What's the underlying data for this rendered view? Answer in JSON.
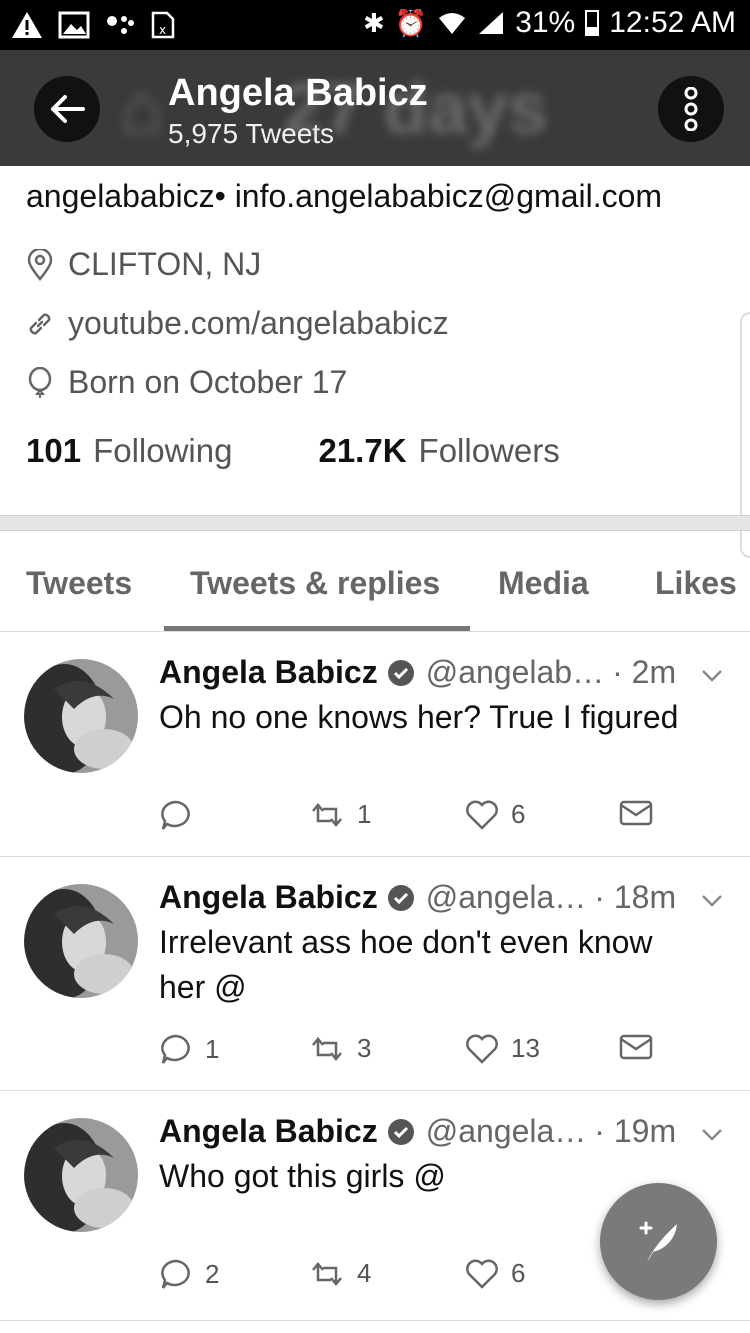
{
  "status_bar": {
    "battery": "31%",
    "time": "12:52 AM"
  },
  "header": {
    "name": "Angela Babicz",
    "tweet_count": "5,975 Tweets"
  },
  "profile": {
    "bio": "angelababicz• info.angelababicz@gmail.com",
    "location": "CLIFTON, NJ",
    "website": "youtube.com/angelababicz",
    "birthday": "Born on October 17",
    "following_count": "101",
    "following_label": "Following",
    "followers_count": "21.7K",
    "followers_label": "Followers"
  },
  "tabs": [
    {
      "label": "Tweets"
    },
    {
      "label": "Tweets & replies"
    },
    {
      "label": "Media"
    },
    {
      "label": "Likes"
    }
  ],
  "tweets": [
    {
      "name": "Angela Babicz",
      "handle": "@angelab…",
      "time": "· 2m",
      "text": "Oh no one knows her? True I figured",
      "replies": "",
      "retweets": "1",
      "likes": "6"
    },
    {
      "name": "Angela Babicz",
      "handle": "@angela…",
      "time": "· 18m",
      "text": "Irrelevant ass hoe don't even know her @",
      "replies": "1",
      "retweets": "3",
      "likes": "13"
    },
    {
      "name": "Angela Babicz",
      "handle": "@angela…",
      "time": "· 19m",
      "text": "Who got this girls @",
      "replies": "2",
      "retweets": "4",
      "likes": "6"
    }
  ],
  "icons": {
    "back": "arrow-left-icon",
    "more": "more-vertical-icon",
    "location": "location-pin-icon",
    "link": "link-icon",
    "birthday": "balloon-icon",
    "reply": "reply-icon",
    "retweet": "retweet-icon",
    "like": "heart-icon",
    "dm": "envelope-icon",
    "compose": "compose-tweet-icon"
  }
}
